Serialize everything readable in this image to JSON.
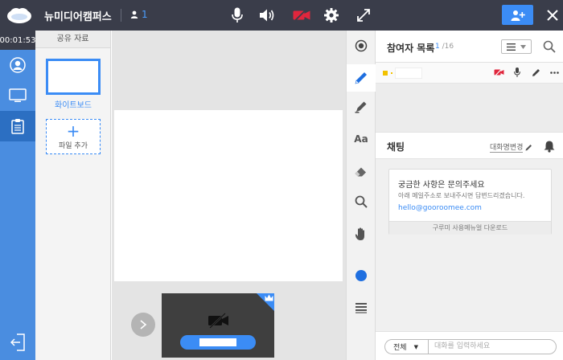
{
  "header": {
    "title": "뉴미디어캠퍼스",
    "participant_count": "1"
  },
  "sidebar": {
    "timer": "00:01:53",
    "items": [
      {
        "name": "profile",
        "icon": "user-icon",
        "active": false
      },
      {
        "name": "screen",
        "icon": "monitor-icon",
        "active": false
      },
      {
        "name": "materials",
        "icon": "clipboard-icon",
        "active": true
      }
    ]
  },
  "materials": {
    "header": "공유 자료",
    "whiteboard_label": "화이트보드",
    "add_plus": "+",
    "add_label": "파일 추가"
  },
  "tools": {
    "text_tool": "Aa",
    "active_tool": "pen",
    "color": "#1f6fe0"
  },
  "participants": {
    "title": "참여자 목록",
    "current": "1",
    "total": "/16"
  },
  "chat": {
    "title": "채팅",
    "rename_label": "대화명변경",
    "notice_title": "궁금한 사항은 문의주세요",
    "notice_sub": "아래 메일주소로 보내주시면 답변드리겠습니다.",
    "notice_email": "hello@gooroomee.com",
    "manual_download": "구루미 사용메뉴얼 다운로드",
    "scope": "전체",
    "scope_arrow": "▼",
    "input_placeholder": "대화를 입력하세요"
  },
  "colors": {
    "accent": "#3b8cf5",
    "topbar": "#3a3d4a",
    "nav": "#4a8de0",
    "nav_active": "#2c6fc2",
    "cam_off": "#e0263d"
  }
}
